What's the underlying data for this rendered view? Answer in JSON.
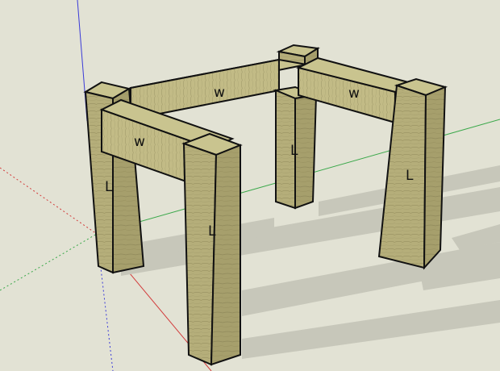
{
  "viewport": {
    "background": "#e2e2d4",
    "axis_colors": {
      "red": "#d23a3a",
      "green": "#3aa84a",
      "blue": "#3a3ad8"
    }
  },
  "model": {
    "wood_colors": {
      "face_top": "#c9c48f",
      "face_front": "#b7b07c",
      "face_side": "#a69f6c",
      "grain": "#8f885a",
      "outline": "#111111",
      "shadow": "#c8c8bb"
    },
    "labels": {
      "rail_back": "w",
      "rail_right": "w",
      "rail_front": "w",
      "leg_back_left": "L",
      "leg_back_right": "L",
      "leg_front_left": "L",
      "leg_front_right": "L"
    }
  }
}
